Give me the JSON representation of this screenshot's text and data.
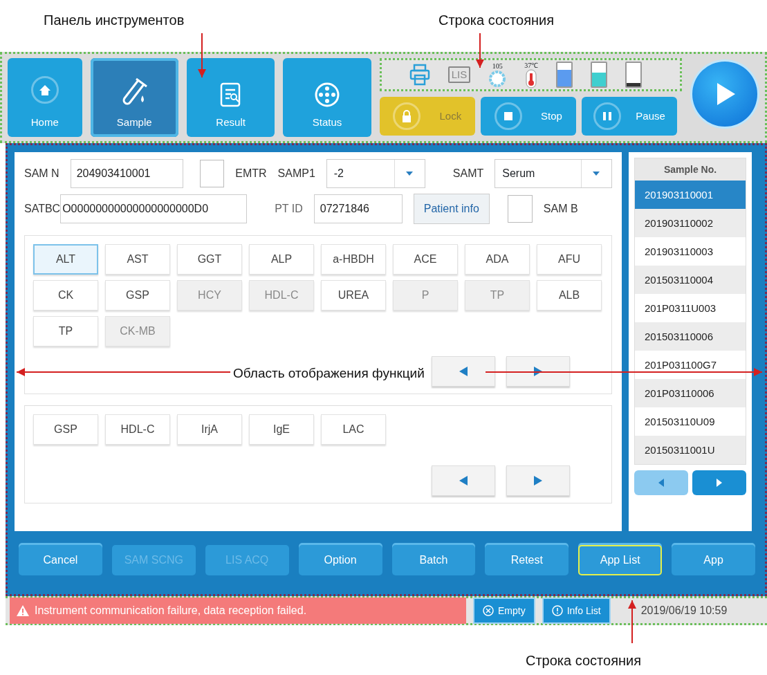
{
  "annotations": [
    {
      "text": "Панель инструментов",
      "kind": "top_left"
    },
    {
      "text": "Строка состояния",
      "kind": "top_right"
    },
    {
      "text": "Область отображения функций",
      "kind": "middle"
    },
    {
      "text": "Строка состояния",
      "kind": "bottom"
    }
  ],
  "toolbar": {
    "nav": [
      {
        "label": "Home",
        "kind": "home",
        "selected": false
      },
      {
        "label": "Sample",
        "kind": "sample",
        "selected": true
      },
      {
        "label": "Result",
        "kind": "result",
        "selected": false
      },
      {
        "label": "Status",
        "kind": "status",
        "selected": false
      }
    ],
    "status_icons": [
      {
        "kind": "printer"
      },
      {
        "kind": "lis",
        "text": "LIS"
      },
      {
        "kind": "gear",
        "text": "105"
      },
      {
        "kind": "thermometer",
        "text": "37℃"
      },
      {
        "kind": "bottle",
        "color": "#5b9bef",
        "level": 0.7
      },
      {
        "kind": "bottle",
        "color": "#3fcfcf",
        "level": 0.6
      },
      {
        "kind": "bottle",
        "color": "#333333",
        "level": 0.15
      }
    ],
    "controls": [
      {
        "label": "Lock",
        "kind": "lock"
      },
      {
        "label": "Stop",
        "kind": "stop"
      },
      {
        "label": "Pause",
        "kind": "pause"
      }
    ],
    "run_button": {
      "kind": "play"
    }
  },
  "form": {
    "sam_n": {
      "label": "SAM N",
      "value": "204903410001"
    },
    "emtr": {
      "label": "EMTR",
      "checked": false
    },
    "samp1": {
      "label": "SAMP1",
      "value": "-2"
    },
    "samt": {
      "label": "SAMT",
      "value": "Serum"
    },
    "satbc": {
      "label": "SATBC",
      "value": "O00000000000000000000D0"
    },
    "pt_id": {
      "label": "PT ID",
      "value": "07271846"
    },
    "patient_info_button": "Patient info",
    "sam_b": {
      "label": "SAM B",
      "checked": false
    }
  },
  "test_panels": [
    {
      "tests": [
        {
          "label": "ALT",
          "selected": true,
          "disabled": false
        },
        {
          "label": "AST",
          "selected": false,
          "disabled": false
        },
        {
          "label": "GGT",
          "selected": false,
          "disabled": false
        },
        {
          "label": "ALP",
          "selected": false,
          "disabled": false
        },
        {
          "label": "a-HBDH",
          "selected": false,
          "disabled": false
        },
        {
          "label": "ACE",
          "selected": false,
          "disabled": false
        },
        {
          "label": "ADA",
          "selected": false,
          "disabled": false
        },
        {
          "label": "AFU",
          "selected": false,
          "disabled": false
        },
        {
          "label": "CK",
          "selected": false,
          "disabled": false
        },
        {
          "label": "GSP",
          "selected": false,
          "disabled": false
        },
        {
          "label": "HCY",
          "selected": false,
          "disabled": true
        },
        {
          "label": "HDL-C",
          "selected": false,
          "disabled": true
        },
        {
          "label": "UREA",
          "selected": false,
          "disabled": false
        },
        {
          "label": "P",
          "selected": false,
          "disabled": true
        },
        {
          "label": "TP",
          "selected": false,
          "disabled": true
        },
        {
          "label": "ALB",
          "selected": false,
          "disabled": false
        },
        {
          "label": "TP",
          "selected": false,
          "disabled": false
        },
        {
          "label": "CK-MB",
          "selected": false,
          "disabled": true
        }
      ]
    },
    {
      "tests": [
        {
          "label": "GSP",
          "selected": false,
          "disabled": false
        },
        {
          "label": "HDL-C",
          "selected": false,
          "disabled": false
        },
        {
          "label": "IrjA",
          "selected": false,
          "disabled": false
        },
        {
          "label": "IgE",
          "selected": false,
          "disabled": false
        },
        {
          "label": "LAC",
          "selected": false,
          "disabled": false
        }
      ]
    }
  ],
  "sample_list": {
    "header": "Sample No.",
    "items": [
      {
        "text": "201903110001",
        "selected": true
      },
      {
        "text": "201903110002",
        "selected": false
      },
      {
        "text": "201903110003",
        "selected": false
      },
      {
        "text": "201503110004",
        "selected": false
      },
      {
        "text": "201P0311U003",
        "selected": false
      },
      {
        "text": "201503110006",
        "selected": false
      },
      {
        "text": "201P031100G7",
        "selected": false
      },
      {
        "text": "201P03110006",
        "selected": false
      },
      {
        "text": "201503110U09",
        "selected": false
      },
      {
        "text": "20150311001U",
        "selected": false
      }
    ],
    "pager": [
      {
        "kind": "prev",
        "disabled": true
      },
      {
        "kind": "next",
        "disabled": false
      }
    ]
  },
  "action_buttons": [
    {
      "label": "Cancel",
      "disabled": false,
      "selected": false
    },
    {
      "label": "SAM SCNG",
      "disabled": true,
      "selected": false
    },
    {
      "label": "LIS ACQ",
      "disabled": true,
      "selected": false
    },
    {
      "label": "Option",
      "disabled": false,
      "selected": false
    },
    {
      "label": "Batch",
      "disabled": false,
      "selected": false
    },
    {
      "label": "Retest",
      "disabled": false,
      "selected": false
    },
    {
      "label": "App List",
      "disabled": false,
      "selected": true
    },
    {
      "label": "App",
      "disabled": false,
      "selected": false
    }
  ],
  "status_bar": {
    "alert": "Instrument communication failure, data reception failed.",
    "buttons": [
      {
        "label": "Empty",
        "kind": "empty"
      },
      {
        "label": "Info List",
        "kind": "info"
      }
    ],
    "datetime": "2019/06/19 10:59"
  }
}
